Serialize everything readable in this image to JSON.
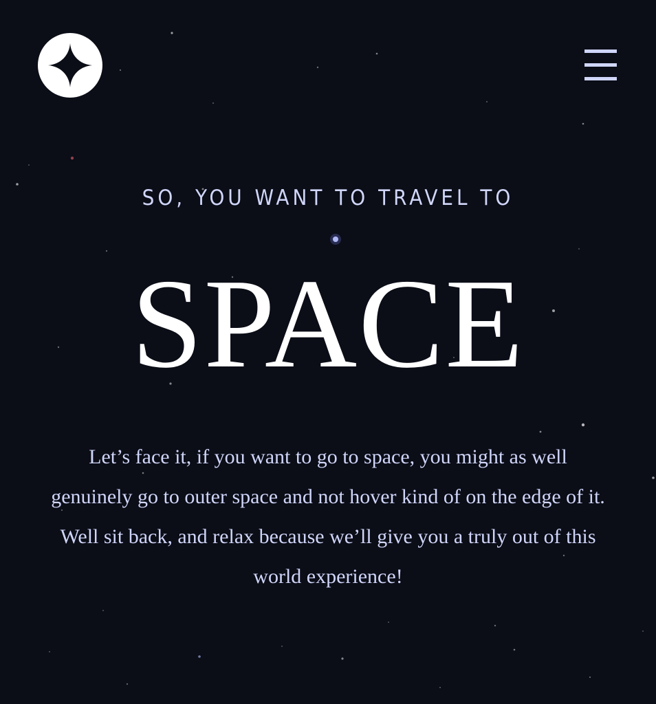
{
  "header": {
    "logo_icon": "four-point-star-icon",
    "menu_icon": "hamburger-icon"
  },
  "hero": {
    "eyebrow": "SO, YOU WANT TO TRAVEL TO",
    "title": "SPACE",
    "intro": "Let’s face it, if you want to go to space, you might as well genuinely go to outer space and not hover kind of on the edge of it. Well sit back, and relax because we’ll give you a truly out of this world experience!"
  },
  "colors": {
    "background": "#0b0d17",
    "text_light": "#d0d6f9",
    "text_white": "#ffffff"
  }
}
